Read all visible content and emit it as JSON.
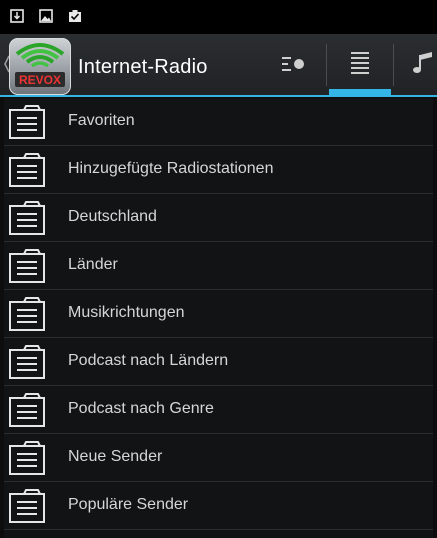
{
  "status_bar": {
    "icons": [
      "download-icon",
      "image-icon",
      "clipboard-check-icon"
    ]
  },
  "action_bar": {
    "title": "Internet-Radio",
    "logo_text": "REVOX",
    "accent_color": "#33b5e5",
    "actions": [
      {
        "name": "queue-icon"
      },
      {
        "name": "list-icon",
        "selected": true
      },
      {
        "name": "music-note-icon"
      }
    ]
  },
  "list": {
    "items": [
      {
        "label": "Favoriten"
      },
      {
        "label": "Hinzugefügte Radiostationen"
      },
      {
        "label": "Deutschland"
      },
      {
        "label": "Länder"
      },
      {
        "label": "Musikrichtungen"
      },
      {
        "label": "Podcast nach Ländern"
      },
      {
        "label": "Podcast nach Genre"
      },
      {
        "label": "Neue Sender"
      },
      {
        "label": "Populäre Sender"
      }
    ]
  }
}
